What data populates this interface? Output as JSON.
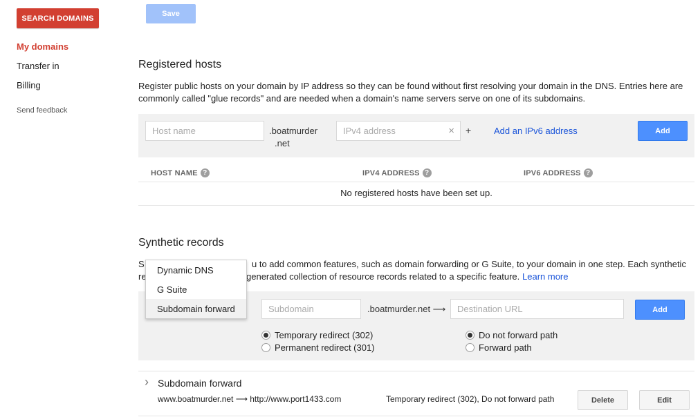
{
  "sidebar": {
    "search_button": "SEARCH DOMAINS",
    "items": [
      {
        "label": "My domains"
      },
      {
        "label": "Transfer in"
      },
      {
        "label": "Billing"
      }
    ],
    "feedback": "Send feedback"
  },
  "toolbar": {
    "save_label": "Save"
  },
  "registered_hosts": {
    "title": "Registered hosts",
    "description": "Register public hosts on your domain by IP address so they can be found without first resolving your domain in the DNS. Entries here are commonly called \"glue records\" and are needed when a domain's name servers serve on one of its subdomains.",
    "host_placeholder": "Host name",
    "domain_suffix_1": ".boatmurder",
    "domain_suffix_2": ".net",
    "ipv4_placeholder": "IPv4 address",
    "clear_glyph": "×",
    "plus": "+",
    "add_ipv6_link": "Add an IPv6 address",
    "add_button": "Add",
    "columns": [
      "HOST NAME",
      "IPV4 ADDRESS",
      "IPV6 ADDRESS"
    ],
    "help_glyph": "?",
    "empty_message": "No registered hosts have been set up."
  },
  "synthetic_records": {
    "title": "Synthetic records",
    "desc_line1_start": "S",
    "desc_line1_end": "u to add common features, such as domain forwarding or G Suite, to your domain in one step. Each synthetic",
    "desc_line2_start": "re",
    "desc_line2_end": "generated collection of resource records related to a specific feature.",
    "learn_more": "Learn more",
    "dropdown_options": [
      "Dynamic DNS",
      "G Suite",
      "Subdomain forward"
    ],
    "subdomain_placeholder": "Subdomain",
    "domain_suffix": ".boatmurder.net ⟶",
    "destination_placeholder": "Destination URL",
    "add_button": "Add",
    "redirect_options": [
      {
        "label": "Temporary redirect (302)",
        "checked": true
      },
      {
        "label": "Permanent redirect (301)",
        "checked": false
      }
    ],
    "path_options": [
      {
        "label": "Do not forward path",
        "checked": true
      },
      {
        "label": "Forward path",
        "checked": false
      }
    ]
  },
  "record": {
    "chevron": "›",
    "title": "Subdomain forward",
    "mapping": "www.boatmurder.net ⟶ http://www.port1433.com",
    "mode": "Temporary redirect (302), Do not forward path",
    "delete_button": "Delete",
    "edit_button": "Edit"
  }
}
